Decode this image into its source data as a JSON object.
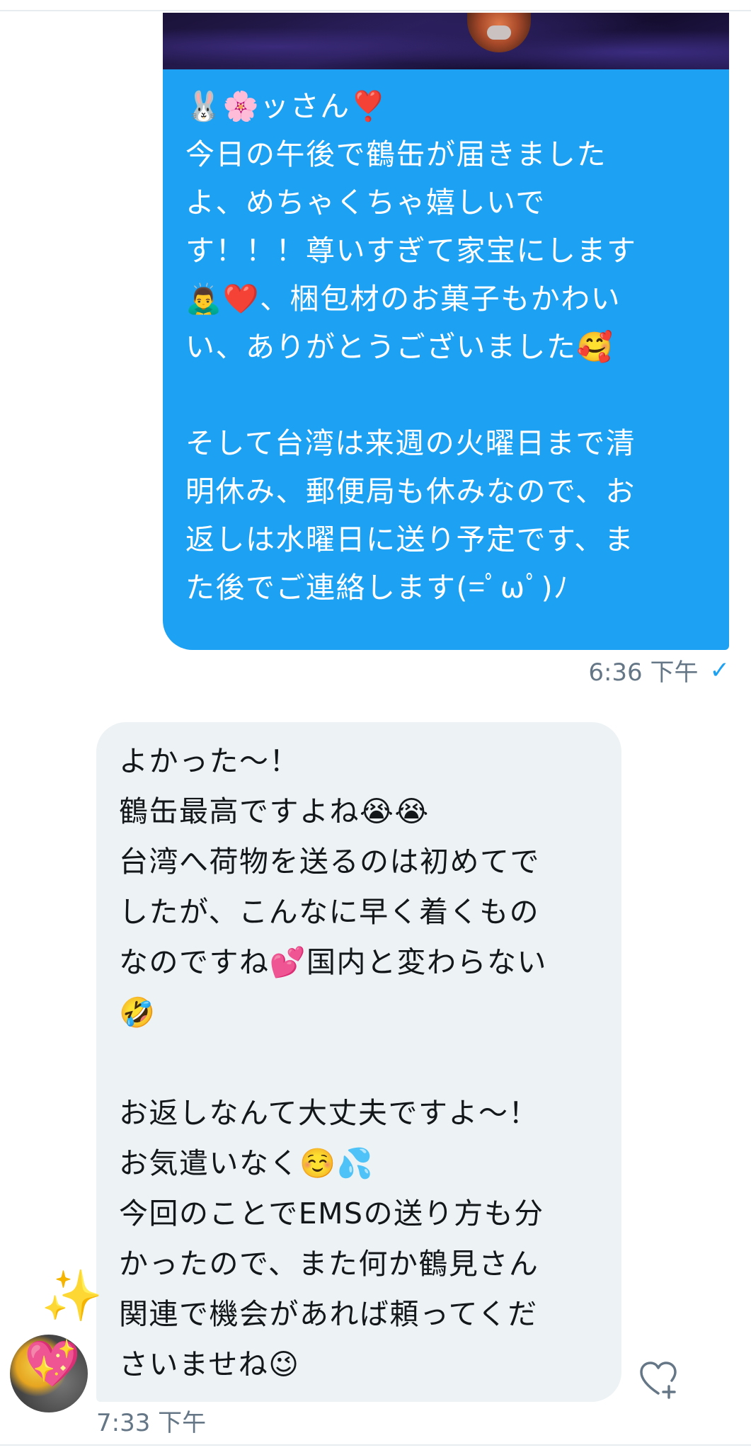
{
  "sent_message": {
    "text": "🐰🌸ッさん❣️\n今日の午後で鶴缶が届きました\nよ、めちゃくちゃ嬉しいで\nす！！！尊いすぎて家宝にします\n🙇‍♂️❤️、梱包材のお菓子もかわい\nい、ありがとうございました🥰\n\nそして台湾は来週の火曜日まで清\n明休み、郵便局も休みなので、お\n返しは水曜日に送り予定です、ま\nた後でご連絡します(=ﾟωﾟ)ﾉ",
    "time": "6:36 下午",
    "status_icon": "check-icon",
    "read_mark": "✓"
  },
  "received_message": {
    "text": "よかった〜！\n鶴缶最高ですよね😭😭\n台湾へ荷物を送るのは初めてで\nしたが、こんなに早く着くもの\nなのですね💕国内と変わらない\n🤣\n\nお返しなんて大丈夫ですよ〜！\nお気遣いなく☺️💦\n今回のことでEMSの送り方も分\nかったので、また何か鶴見さん\n関連で機会があれば頼ってくだ\nさいませね😉",
    "time": "7:33 下午",
    "avatar_emoji": "💖",
    "sparkle_emoji": "✨"
  },
  "colors": {
    "sent_bubble": "#1da1f2",
    "received_bubble": "#edf2f4",
    "meta_text": "#657786"
  }
}
